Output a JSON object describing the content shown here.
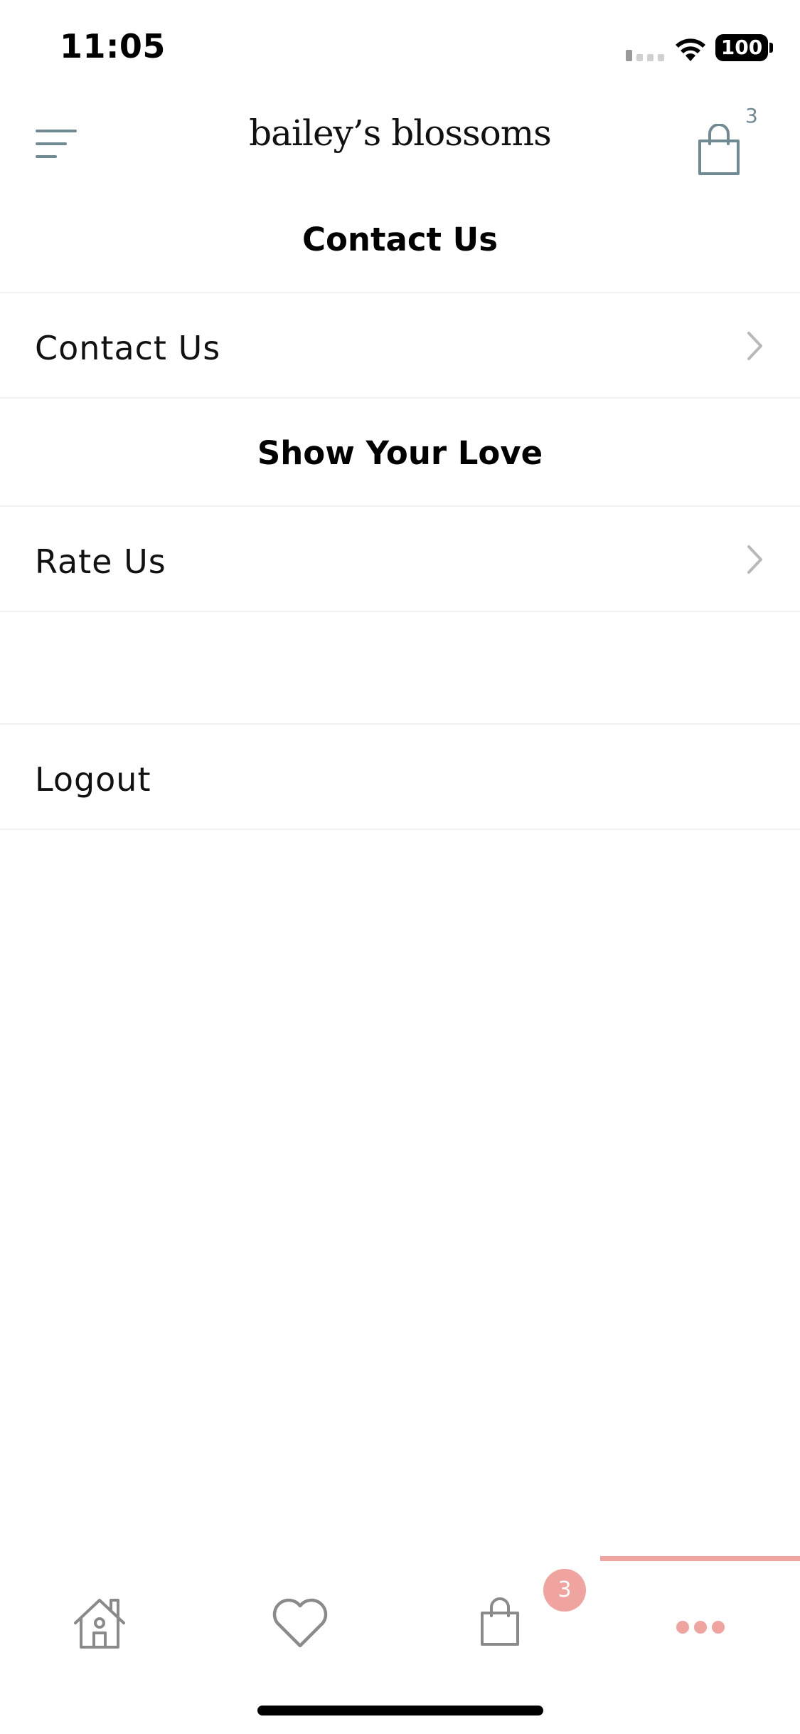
{
  "status_bar": {
    "time": "11:05",
    "battery": "100"
  },
  "header": {
    "brand": "bailey’s blossoms",
    "cart_count": "3"
  },
  "sections": {
    "contact_header": "Contact Us",
    "contact_row": "Contact Us",
    "love_header": "Show Your Love",
    "rate_row": "Rate Us",
    "logout_row": "Logout"
  },
  "tab_bar": {
    "tabs": [
      {
        "icon": "home-icon"
      },
      {
        "icon": "heart-icon"
      },
      {
        "icon": "bag-icon",
        "badge": "3"
      },
      {
        "icon": "more-icon",
        "active": true
      }
    ],
    "accent_color": "#f0a49f",
    "icon_color": "#8a8a8a"
  },
  "colors": {
    "brand_icon": "#6f8a93",
    "accent": "#f0a49f",
    "divider": "#f1f1f1"
  }
}
